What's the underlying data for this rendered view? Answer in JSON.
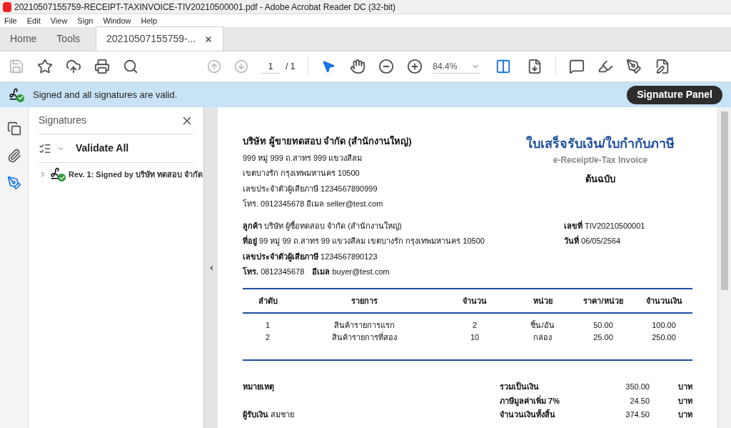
{
  "window": {
    "title": "20210507155759-RECEIPT-TAXINVOICE-TIV20210500001.pdf - Adobe Acrobat Reader DC (32-bit)"
  },
  "menu": [
    "File",
    "Edit",
    "View",
    "Sign",
    "Window",
    "Help"
  ],
  "tabs": [
    {
      "label": "Home",
      "selected": false,
      "closable": false
    },
    {
      "label": "Tools",
      "selected": false,
      "closable": false
    },
    {
      "label": "20210507155759-...",
      "selected": true,
      "closable": true
    }
  ],
  "toolbar": {
    "page_number": "1",
    "page_total": "/ 1",
    "zoom": "84.4%"
  },
  "banner": {
    "message": "Signed and all signatures are valid.",
    "button": "Signature Panel"
  },
  "left_rail": [
    {
      "kind": "pages",
      "selected": false
    },
    {
      "kind": "attachments",
      "selected": false
    },
    {
      "kind": "signatures",
      "selected": true
    }
  ],
  "signatures_panel": {
    "title": "Signatures",
    "validate_button": "Validate All",
    "items": [
      {
        "label": "Rev. 1: Signed by บริษัท ทดสอบ จำกัด",
        "expanded": false
      }
    ]
  },
  "document": {
    "seller_name": "บริษัท ผู้ขายทดสอบ จำกัด (สำนักงานใหญ่)",
    "seller_lines": [
      "999 หมู่ 999 ถ.สาทร 999 แขวงสีลม",
      "เขตบางรัก  กรุงเทพมหานคร 10500",
      "เลขประจำตัวผู้เสียภาษี 1234567890999",
      "โทร. 0912345678  อีเมล seller@test.com"
    ],
    "doc_title": "ใบเสร็จรับเงิน/ใบกำกับภาษี",
    "doc_subtitle": "e-Receipt/e-Tax Invoice",
    "copy_label": "ต้นฉบับ",
    "buyer_lines": [
      {
        "label": "ลูกค้า",
        "value": "บริษัท ผู้ซื้อทดสอบ จำกัด (สำนักงานใหญ่)"
      },
      {
        "label": "ที่อยู่",
        "value": "99 หมู่ 99 ถ.สาทร 99 แขวงสีลม เขตบางรัก กรุงเทพมหานคร 10500"
      },
      {
        "label": "เลขประจำตัวผู้เสียภาษี",
        "value": "1234567890123"
      },
      {
        "label": "โทร.",
        "value": "0812345678",
        "label2": "อีเมล",
        "value2": "buyer@test.com"
      }
    ],
    "meta": [
      {
        "label": "เลขที่",
        "value": "TIV20210500001"
      },
      {
        "label": "วันที่",
        "value": "06/05/2564"
      }
    ],
    "columns": [
      "ลำดับ",
      "รายการ",
      "จำนวน",
      "หน่วย",
      "ราคา/หน่วย",
      "จำนวนเงิน"
    ],
    "rows": [
      [
        "1",
        "สินค้ารายการแรก",
        "2",
        "ชิ้น/อัน",
        "50.00",
        "100.00"
      ],
      [
        "2",
        "สินค้ารายการที่สอง",
        "10",
        "กล่อง",
        "25.00",
        "250.00"
      ]
    ],
    "notes_label": "หมายเหตุ",
    "payer": {
      "label": "ผู้รับเงิน",
      "value": "สมชาย"
    },
    "totals": [
      {
        "label": "รวมเป็นเงิน",
        "value": "350.00",
        "unit": "บาท"
      },
      {
        "label": "ภาษีมูลค่าเพิ่ม 7%",
        "value": "24.50",
        "unit": "บาท"
      },
      {
        "label": "จำนวนเงินทั้งสิ้น",
        "value": "374.50",
        "unit": "บาท"
      }
    ]
  }
}
